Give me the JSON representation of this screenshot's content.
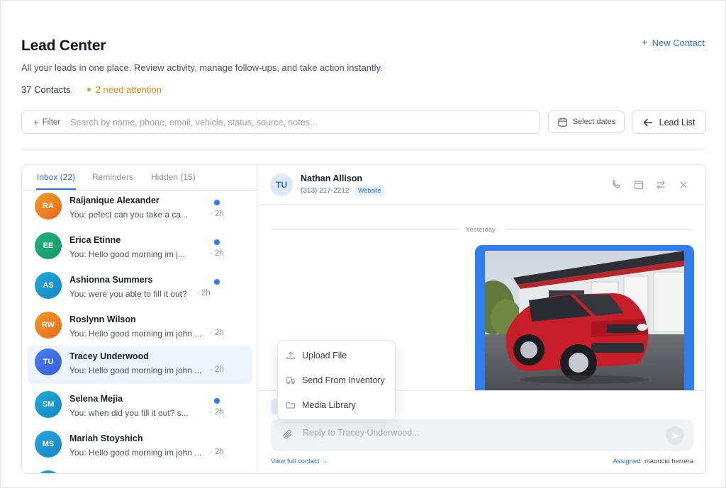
{
  "header": {
    "title": "Lead Center",
    "subtitle": "All your leads in one place. Review activity, manage follow-ups, and take action instantly.",
    "contacts_count": "37 Contacts",
    "attention": "2 need attention",
    "new_contact_label": "New Contact"
  },
  "toolbar": {
    "filter_label": "Filter",
    "search_placeholder": "Search by name, phone, email, vehicle, status, source, notes...",
    "search_value": "",
    "dates_label": "Select dates",
    "lead_list_label": "Lead List"
  },
  "tabs": [
    {
      "label": "Inbox (22)",
      "active": true
    },
    {
      "label": "Reminders",
      "active": false
    },
    {
      "label": "Hidden (15)",
      "active": false
    }
  ],
  "contacts": [
    {
      "initials": "RA",
      "name": "Raijanique Alexander",
      "preview": "You: pefect can you take a ca...",
      "time": "2h",
      "unread": true,
      "color": "orange"
    },
    {
      "initials": "EE",
      "name": "Erica Etinne",
      "preview": "You: Hello good morning im j...",
      "time": "2h",
      "unread": true,
      "color": "green"
    },
    {
      "initials": "AS",
      "name": "Ashionna Summers",
      "preview": "You: were you able to fill it out?",
      "time": "2h",
      "unread": true,
      "color": "teal"
    },
    {
      "initials": "RW",
      "name": "Roslynn Wilson",
      "preview": "You: Hello good morning im john ...",
      "time": "2h",
      "unread": false,
      "color": "orange"
    },
    {
      "initials": "TU",
      "name": "Tracey Underwood",
      "preview": "You: Hello good morning im john ...",
      "time": "2h",
      "unread": false,
      "color": "indigo",
      "active": true
    },
    {
      "initials": "SM",
      "name": "Selena Mejia",
      "preview": "You: when did you fill it out? s...",
      "time": "2h",
      "unread": true,
      "color": "teal"
    },
    {
      "initials": "MS",
      "name": "Mariah Stoyshich",
      "preview": "You: Hello good morning im john ...",
      "time": "2h",
      "unread": false,
      "color": "teal"
    }
  ],
  "chat": {
    "avatar_initials": "TU",
    "name": "Nathan Allison",
    "phone": "(313) 217-2212",
    "source_badge": "Website",
    "day_label": "Yesterday",
    "reply_placeholder": "Reply to Tracey Underwood...",
    "view_full_label": "View full contact →",
    "assigned_label": "Assigned:",
    "assigned_to": "mauricio herrera"
  },
  "attach_menu": [
    {
      "label": "Upload File",
      "icon": "upload-icon"
    },
    {
      "label": "Send From Inventory",
      "icon": "truck-icon"
    },
    {
      "label": "Media Library",
      "icon": "folder-icon"
    }
  ],
  "colors": {
    "accent": "#2f6fd0",
    "attention": "#e08a14",
    "unread_dot": "#2f7ef0",
    "photo_frame": "#2f7ef0"
  }
}
